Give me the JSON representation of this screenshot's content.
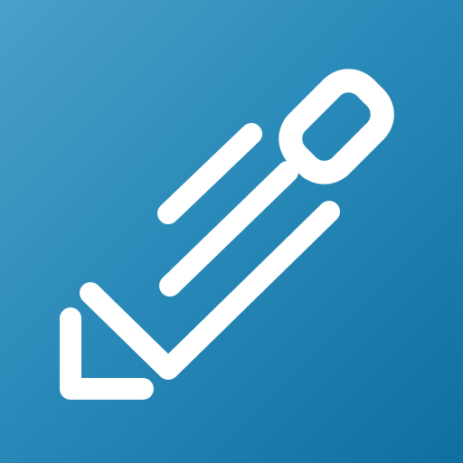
{
  "icon": {
    "name": "pencil-edit-icon",
    "colors": {
      "background_top": "#4aa0c8",
      "background_bottom": "#0f6f9f",
      "glyph": "#ffffff"
    }
  }
}
